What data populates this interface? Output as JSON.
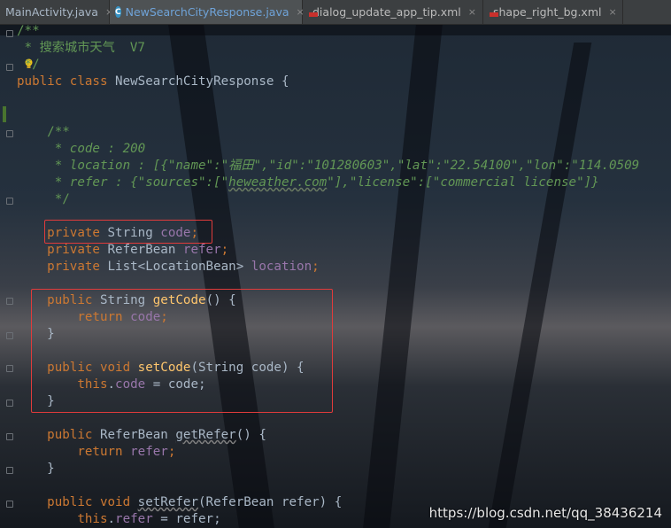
{
  "tabs": [
    {
      "label": "MainActivity.java",
      "type": "java"
    },
    {
      "label": "NewSearchCityResponse.java",
      "type": "class",
      "active": true
    },
    {
      "label": "dialog_update_app_tip.xml",
      "type": "xml"
    },
    {
      "label": "shape_right_bg.xml",
      "type": "xml"
    }
  ],
  "close_glyph": "×",
  "code": {
    "l1": "/**",
    "l2": " * 搜索城市天气  V7",
    "l3": " */",
    "l4_a": "public class ",
    "l4_b": "NewSearchCityResponse {",
    "l6": "    /**",
    "l7": "     * code : 200",
    "l8_a": "     * location : [{\"name\":\"福田\",\"id\":\"101280603\",\"lat\":\"22.54100\",\"lon\":\"114.0509",
    "l9_a": "     * refer : {\"sources\":[\"",
    "l9_b": "heweather.com",
    "l9_c": "\"],\"license\":[\"commercial license\"]}",
    "l10": "     */",
    "f1_a": "    private ",
    "f1_b": "String ",
    "f1_c": "code",
    "f1_d": ";",
    "f2_a": "    private ",
    "f2_b": "ReferBean ",
    "f2_c": "refer",
    "f2_d": ";",
    "f3_a": "    private ",
    "f3_b": "List<LocationBean> ",
    "f3_c": "location",
    "f3_d": ";",
    "m1_a": "    public ",
    "m1_b": "String ",
    "m1_c": "getCode",
    "m1_d": "() {",
    "m1r_a": "        return ",
    "m1r_b": "code",
    "m1r_c": ";",
    "close": "    }",
    "m2_a": "    public void ",
    "m2_b": "setCode",
    "m2_c": "(String code) {",
    "m2r_a": "        this",
    "m2r_b": ".",
    "m2r_c": "code",
    "m2r_d": " = code;",
    "m3_a": "    public ",
    "m3_b": "ReferBean ",
    "m3_c": "getRefer",
    "m3_d": "() {",
    "m3r_a": "        return ",
    "m3r_b": "refer",
    "m3r_c": ";",
    "m4_a": "    public void ",
    "m4_b": "setRefer",
    "m4_c": "(ReferBean refer) {",
    "m4r_a": "        this",
    "m4r_b": ".",
    "m4r_c": "refer",
    "m4r_d": " = refer;"
  },
  "watermark": "https://blog.csdn.net/qq_38436214",
  "colors": {
    "keyword": "#cc7832",
    "field": "#9876aa",
    "method": "#ffc66d",
    "comment": "#629755",
    "highlight_box": "#e03b3b"
  }
}
